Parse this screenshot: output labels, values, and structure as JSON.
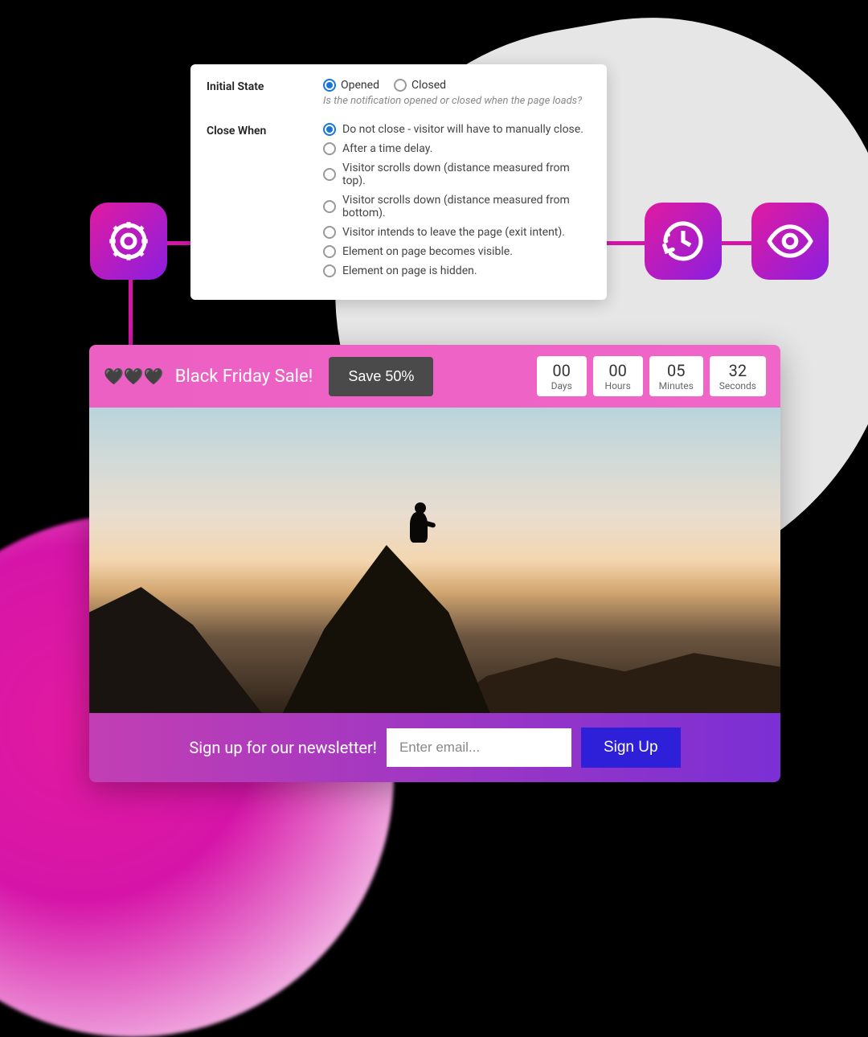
{
  "settings": {
    "initial_state": {
      "label": "Initial State",
      "options": [
        "Opened",
        "Closed"
      ],
      "selected": 0,
      "hint": "Is the notification opened or closed when the page loads?"
    },
    "close_when": {
      "label": "Close When",
      "options": [
        "Do not close - visitor will have to manually close.",
        "After a time delay.",
        "Visitor scrolls down (distance measured from top).",
        "Visitor scrolls down (distance measured from bottom).",
        "Visitor intends to leave the page (exit intent).",
        "Element on page becomes visible.",
        "Element on page is hidden."
      ],
      "selected": 0
    }
  },
  "preview": {
    "topbar": {
      "hearts": "🖤🖤🖤",
      "title": "Black Friday Sale!",
      "save_button": "Save 50%",
      "countdown": [
        {
          "value": "00",
          "label": "Days"
        },
        {
          "value": "00",
          "label": "Hours"
        },
        {
          "value": "05",
          "label": "Minutes"
        },
        {
          "value": "32",
          "label": "Seconds"
        }
      ]
    },
    "bottombar": {
      "text": "Sign up for our newsletter!",
      "placeholder": "Enter email...",
      "button": "Sign Up"
    }
  }
}
